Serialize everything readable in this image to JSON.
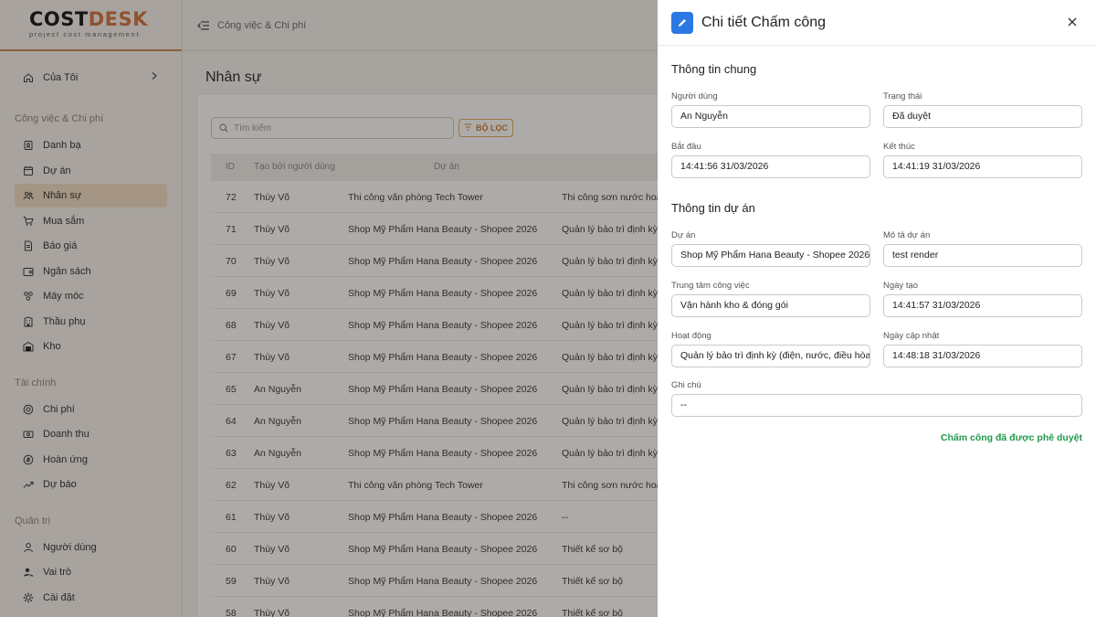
{
  "sidebar": {
    "logo_main_a": "COST",
    "logo_main_b": "DESK",
    "logo_sub": "project cost management",
    "my": {
      "label": "Của Tôi",
      "icon": "home-icon"
    },
    "sections": [
      {
        "title": "Công việc & Chi phí",
        "items": [
          {
            "label": "Danh bạ",
            "icon": "contacts-icon"
          },
          {
            "label": "Dự án",
            "icon": "project-icon"
          },
          {
            "label": "Nhân sự",
            "icon": "people-icon",
            "active": true
          },
          {
            "label": "Mua sắm",
            "icon": "cart-icon"
          },
          {
            "label": "Báo giá",
            "icon": "quote-icon"
          },
          {
            "label": "Ngân sách",
            "icon": "wallet-icon"
          },
          {
            "label": "Máy móc",
            "icon": "machine-icon"
          },
          {
            "label": "Thầu phụ",
            "icon": "building-icon"
          },
          {
            "label": "Kho",
            "icon": "warehouse-icon"
          }
        ]
      },
      {
        "title": "Tài chính",
        "items": [
          {
            "label": "Chi phí",
            "icon": "coin-icon"
          },
          {
            "label": "Doanh thu",
            "icon": "revenue-icon"
          },
          {
            "label": "Hoàn ứng",
            "icon": "refund-icon"
          },
          {
            "label": "Dự báo",
            "icon": "trend-icon"
          }
        ]
      },
      {
        "title": "Quản trị",
        "items": [
          {
            "label": "Người dùng",
            "icon": "user-icon"
          },
          {
            "label": "Vai trò",
            "icon": "role-icon"
          },
          {
            "label": "Cài đặt",
            "icon": "gear-icon"
          }
        ]
      }
    ]
  },
  "topbar": {
    "breadcrumb": "Công việc & Chi phí"
  },
  "main": {
    "title": "Nhân sự",
    "search_placeholder": "Tìm kiếm",
    "filter_label": "BỘ LỌC",
    "columns": [
      "ID",
      "Tạo bởi người dùng",
      "Dự án"
    ],
    "rows": [
      [
        "72",
        "Thùy Võ",
        "Thi công văn phòng Tech Tower",
        "Thi công sơn nước hoàn thiện"
      ],
      [
        "71",
        "Thùy Võ",
        "Shop Mỹ Phẩm Hana Beauty - Shopee 2026",
        "Quản lý bảo trì định kỳ"
      ],
      [
        "70",
        "Thùy Võ",
        "Shop Mỹ Phẩm Hana Beauty - Shopee 2026",
        "Quản lý bảo trì định kỳ"
      ],
      [
        "69",
        "Thùy Võ",
        "Shop Mỹ Phẩm Hana Beauty - Shopee 2026",
        "Quản lý bảo trì định kỳ"
      ],
      [
        "68",
        "Thùy Võ",
        "Shop Mỹ Phẩm Hana Beauty - Shopee 2026",
        "Quản lý bảo trì định kỳ"
      ],
      [
        "67",
        "Thùy Võ",
        "Shop Mỹ Phẩm Hana Beauty - Shopee 2026",
        "Quản lý bảo trì định kỳ"
      ],
      [
        "65",
        "An Nguyễn",
        "Shop Mỹ Phẩm Hana Beauty - Shopee 2026",
        "Quản lý bảo trì định kỳ"
      ],
      [
        "64",
        "An Nguyễn",
        "Shop Mỹ Phẩm Hana Beauty - Shopee 2026",
        "Quản lý bảo trì định kỳ"
      ],
      [
        "63",
        "An Nguyễn",
        "Shop Mỹ Phẩm Hana Beauty - Shopee 2026",
        "Quản lý bảo trì định kỳ"
      ],
      [
        "62",
        "Thùy Võ",
        "Thi công văn phòng Tech Tower",
        "Thi công sơn nước hoàn thiện"
      ],
      [
        "61",
        "Thùy Võ",
        "Shop Mỹ Phẩm Hana Beauty - Shopee 2026",
        "--"
      ],
      [
        "60",
        "Thùy Võ",
        "Shop Mỹ Phẩm Hana Beauty - Shopee 2026",
        "Thiết kế sơ bộ"
      ],
      [
        "59",
        "Thùy Võ",
        "Shop Mỹ Phẩm Hana Beauty - Shopee 2026",
        "Thiết kế sơ bộ"
      ],
      [
        "58",
        "Thùy Võ",
        "Shop Mỹ Phẩm Hana Beauty - Shopee 2026",
        "Thiết kế sơ bộ"
      ]
    ]
  },
  "drawer": {
    "title": "Chi tiết Chấm công",
    "section_general": "Thông tin chung",
    "section_project": "Thông tin dự án",
    "fields": {
      "user": {
        "label": "Người dùng",
        "value": "An Nguyễn"
      },
      "status": {
        "label": "Trạng thái",
        "value": "Đã duyệt"
      },
      "start": {
        "label": "Bắt đầu",
        "value": "14:41:56 31/03/2026"
      },
      "end": {
        "label": "Kết thúc",
        "value": "14:41:19 31/03/2026"
      },
      "project": {
        "label": "Dự án",
        "value": "Shop Mỹ Phẩm Hana Beauty - Shopee 2026"
      },
      "project_desc": {
        "label": "Mô tả dự án",
        "value": "test render"
      },
      "work_center": {
        "label": "Trung tâm công việc",
        "value": "Vận hành kho & đóng gói"
      },
      "created": {
        "label": "Ngày tạo",
        "value": "14:41:57 31/03/2026"
      },
      "activity": {
        "label": "Hoạt động",
        "value": "Quản lý bảo trì định kỳ (điện, nước, điều hòa)"
      },
      "updated": {
        "label": "Ngày cập nhật",
        "value": "14:48:18 31/03/2026"
      },
      "note": {
        "label": "Ghi chú",
        "value": "--"
      }
    },
    "approved_text": "Chấm công đã được phê duyệt"
  },
  "colors": {
    "accent": "#d0703a",
    "primary": "#2b78e4",
    "success": "#1f9a4a",
    "active_nav": "#f1dcc4"
  }
}
